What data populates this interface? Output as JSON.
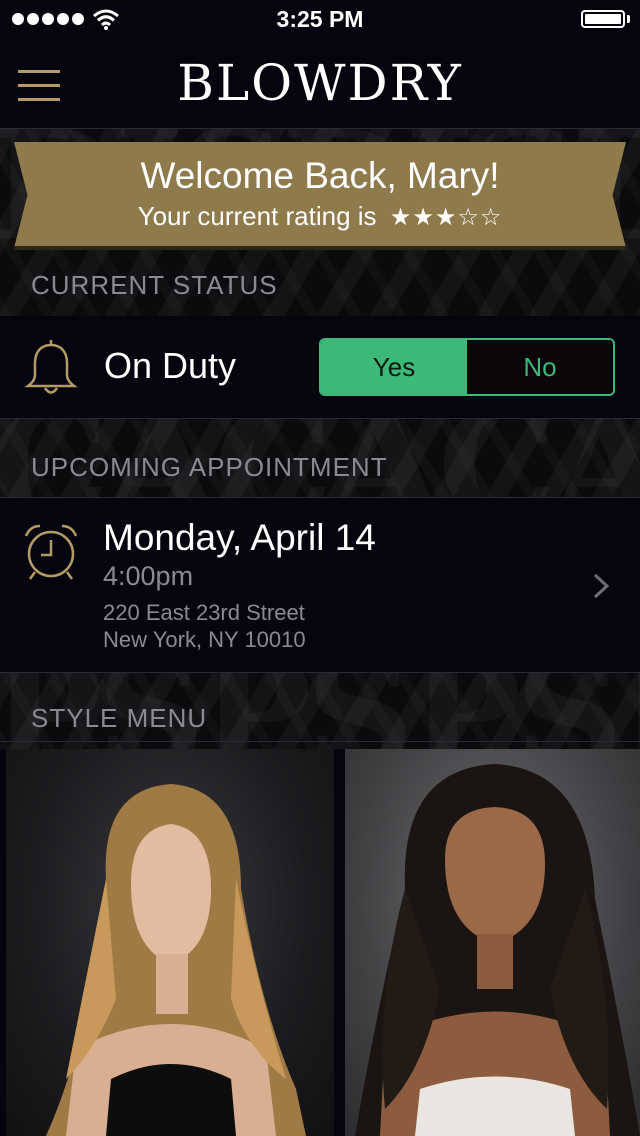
{
  "status_bar": {
    "time": "3:25 PM",
    "signal_icon": "signal-dots-icon",
    "wifi_icon": "wifi-icon",
    "battery_icon": "battery-icon",
    "battery_level": 1.0
  },
  "nav": {
    "title": "BLOWDRY",
    "menu_icon": "hamburger-menu-icon"
  },
  "banner": {
    "welcome": "Welcome Back, Mary!",
    "rating_text": "Your current rating is",
    "rating": 3,
    "rating_max": 5
  },
  "current_status": {
    "heading": "CURRENT STATUS",
    "icon": "bell-icon",
    "label": "On Duty",
    "options": [
      "Yes",
      "No"
    ],
    "selected": "Yes"
  },
  "upcoming_appointment": {
    "heading": "UPCOMING APPOINTMENT",
    "icon": "alarm-clock-icon",
    "date": "Monday, April 14",
    "time": "4:00pm",
    "address_line1": "220 East 23rd Street",
    "address_line2": "New York, NY 10010"
  },
  "style_menu": {
    "heading": "STYLE MENU",
    "items": [
      {
        "name": "blonde-waves-style"
      },
      {
        "name": "dark-curls-style"
      }
    ]
  },
  "colors": {
    "background": "#05050f",
    "gold": "#b59b63",
    "ribbon": "#8f7a4b",
    "green": "#3cb878",
    "muted_text": "#8a8a92"
  }
}
